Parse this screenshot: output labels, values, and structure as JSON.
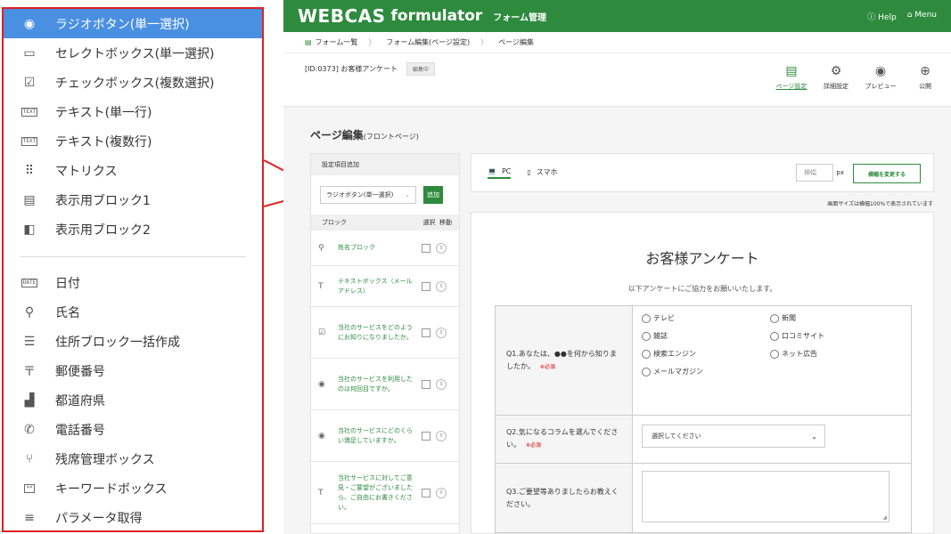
{
  "panel": {
    "items_top": [
      {
        "icon": "radio-icon",
        "label": "ラジオボタン(単一選択)",
        "active": true
      },
      {
        "icon": "select-icon",
        "label": "セレクトボックス(単一選択)"
      },
      {
        "icon": "checkbox-icon",
        "label": "チェックボックス(複数選択)"
      },
      {
        "icon": "text-single-icon",
        "label": "テキスト(単一行)",
        "icon_text": "TEXT"
      },
      {
        "icon": "text-multi-icon",
        "label": "テキスト(複数行)",
        "icon_text": "TEXT"
      },
      {
        "icon": "matrix-icon",
        "label": "マトリクス"
      },
      {
        "icon": "display-block-1-icon",
        "label": "表示用ブロック1"
      },
      {
        "icon": "display-block-2-icon",
        "label": "表示用ブロック2"
      }
    ],
    "items_bottom": [
      {
        "icon": "date-icon",
        "label": "日付",
        "icon_text": "DATE"
      },
      {
        "icon": "person-icon",
        "label": "氏名"
      },
      {
        "icon": "address-icon",
        "label": "住所ブロック一括作成"
      },
      {
        "icon": "postal-icon",
        "label": "郵便番号"
      },
      {
        "icon": "prefecture-icon",
        "label": "都道府県"
      },
      {
        "icon": "phone-icon",
        "label": "電話番号"
      },
      {
        "icon": "seat-icon",
        "label": "残席管理ボックス"
      },
      {
        "icon": "keyword-icon",
        "label": "キーワードボックス",
        "icon_text": "**"
      },
      {
        "icon": "parameter-icon",
        "label": "パラメータ取得"
      }
    ]
  },
  "app": {
    "logo": "WEBCAS",
    "logo_sub": "formulator",
    "logo_jp": "フォーム管理",
    "help": "Help",
    "menu": "Menu",
    "breadcrumb": [
      "フォーム一覧",
      "フォーム編集(ページ設定)",
      "ページ編集"
    ],
    "id_title": "[ID:0373] お客様アンケート",
    "status": "編集中",
    "actions": [
      {
        "label": "ページ設定",
        "icon": "page-settings-icon",
        "active": true
      },
      {
        "label": "詳細設定",
        "icon": "detail-settings-icon"
      },
      {
        "label": "プレビュー",
        "icon": "preview-icon"
      },
      {
        "label": "公開",
        "icon": "publish-icon"
      }
    ],
    "page_title": "ページ編集",
    "page_title_small": "(フロントページ)",
    "side": {
      "add_header": "設定項目追加",
      "select_value": "ラジオボタン(単一選択)",
      "add_button": "追加",
      "block_header": "ブロック",
      "col_select": "選択",
      "col_move": "移動",
      "blocks": [
        {
          "icon": "person-icon",
          "label": "姓名ブロック",
          "h": 40
        },
        {
          "icon": "text-icon",
          "label": "テキストボックス（メールアドレス）",
          "h": 46
        },
        {
          "icon": "checkbox-icon",
          "label": "当社のサービスをどのようにお知りになりましたか。",
          "h": 58
        },
        {
          "icon": "radio-icon",
          "label": "当社のサービスを利用したのは何回目ですか。",
          "h": 58
        },
        {
          "icon": "radio-icon",
          "label": "当社のサービスにどのくらい満足していますか。",
          "h": 58
        },
        {
          "icon": "text-multi-icon",
          "label": "当社サービスに対してご意見・ご要望がございましたら、ご自由にお書きください。",
          "h": 70
        }
      ]
    },
    "preview": {
      "tab_pc": "PC",
      "tab_sp": "スマホ",
      "width_placeholder": "横幅",
      "px": "px",
      "change_button": "横幅を変更する",
      "size_note": "画面サイズは横幅100%で表示されています",
      "form_title": "お客様アンケート",
      "form_sub": "以下アンケートにご協力をお願いいたします。",
      "q1": {
        "label": "Q1.あなたは、●●を何から知りましたか。",
        "required": "※必須",
        "options": [
          "テレビ",
          "新聞",
          "雑誌",
          "口コミサイト",
          "検索エンジン",
          "ネット広告",
          "メールマガジン"
        ]
      },
      "q2": {
        "label": "Q2.気になるコラムを選んでください。",
        "required": "※必須",
        "select": "選択してください"
      },
      "q3": {
        "label": "Q3.ご要望等ありましたらお教えください。"
      }
    }
  }
}
